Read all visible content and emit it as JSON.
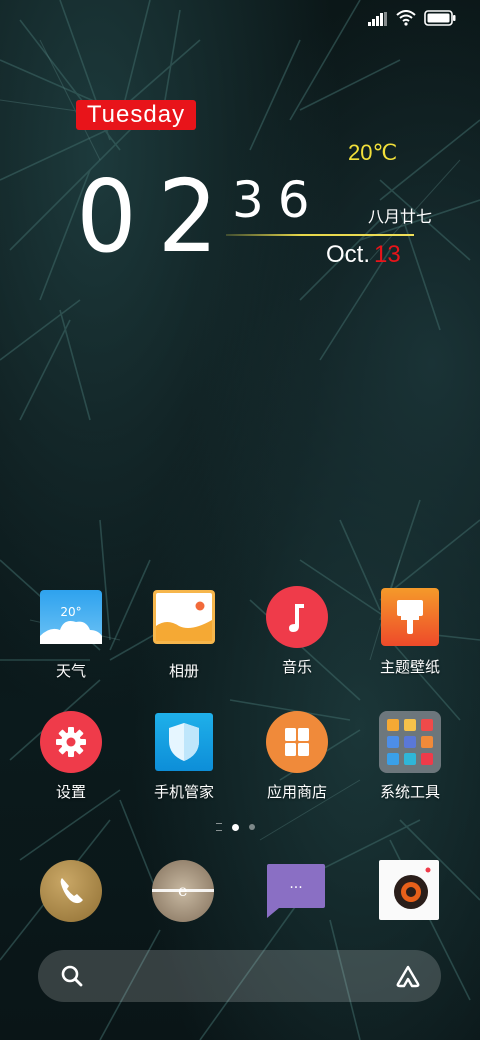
{
  "status_bar": {
    "signal_icon": "signal-icon",
    "wifi_icon": "wifi-icon",
    "battery_icon": "battery-icon"
  },
  "clock_widget": {
    "weekday": "Tuesday",
    "hour": "02",
    "minute": "36",
    "temperature": "20℃",
    "lunar_date": "八月廿七",
    "month": "Oct.",
    "day": "13",
    "accent_red": "#e8141a",
    "accent_yellow": "#f2e03a"
  },
  "apps_row1": [
    {
      "label": "天气",
      "icon": "weather-icon",
      "icon_text": "20°"
    },
    {
      "label": "相册",
      "icon": "gallery-icon"
    },
    {
      "label": "音乐",
      "icon": "music-icon"
    },
    {
      "label": "主题壁纸",
      "icon": "themes-icon"
    }
  ],
  "apps_row2": [
    {
      "label": "设置",
      "icon": "settings-icon"
    },
    {
      "label": "手机管家",
      "icon": "security-icon"
    },
    {
      "label": "应用商店",
      "icon": "app-store-icon"
    },
    {
      "label": "系统工具",
      "icon": "system-tools-folder-icon"
    }
  ],
  "dock": [
    {
      "icon": "phone-icon"
    },
    {
      "icon": "browser-icon",
      "icon_text": "e"
    },
    {
      "icon": "messages-icon",
      "icon_text": "···"
    },
    {
      "icon": "camera-icon"
    }
  ],
  "search_bar": {
    "search_icon": "search-icon",
    "assistant_icon": "assistant-icon"
  }
}
